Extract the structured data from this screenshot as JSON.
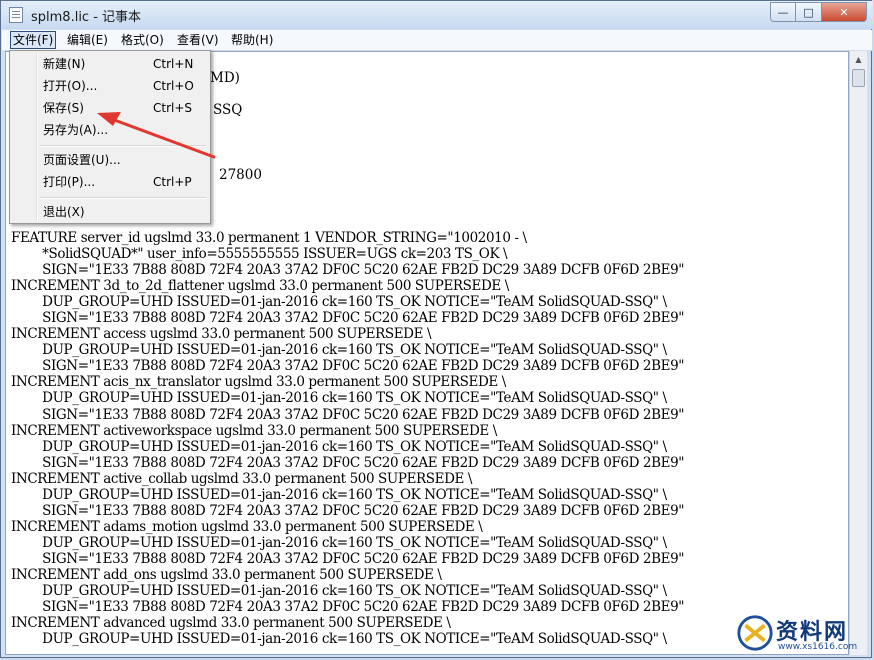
{
  "window": {
    "title": "splm8.lic - 记事本"
  },
  "title_buttons": {
    "minimize": "—",
    "maximize": "□",
    "close": "✕"
  },
  "menubar": [
    {
      "label": "文件(F)"
    },
    {
      "label": "编辑(E)"
    },
    {
      "label": "格式(O)"
    },
    {
      "label": "查看(V)"
    },
    {
      "label": "帮助(H)"
    }
  ],
  "file_menu": {
    "items": [
      {
        "label": "新建(N)",
        "accel": "Ctrl+N"
      },
      {
        "label": "打开(O)...",
        "accel": "Ctrl+O"
      },
      {
        "label": "保存(S)",
        "accel": "Ctrl+S"
      },
      {
        "label": "另存为(A)...",
        "accel": ""
      },
      {
        "label": "页面设置(U)...",
        "accel": ""
      },
      {
        "label": "打印(P)...",
        "accel": "Ctrl+P"
      },
      {
        "label": "退出(X)",
        "accel": ""
      }
    ]
  },
  "hidden_fragments": [
    "MD)",
    "SSQ",
    "27800"
  ],
  "document_text": "FEATURE server_id ugslmd 33.0 permanent 1 VENDOR_STRING=\"1002010 - \\\n\t*SolidSQUAD*\" user_info=5555555555 ISSUER=UGS ck=203 TS_OK \\\n\tSIGN=\"1E33 7B88 808D 72F4 20A3 37A2 DF0C 5C20 62AE FB2D DC29 3A89 DCFB 0F6D 2BE9\"\nINCREMENT 3d_to_2d_flattener ugslmd 33.0 permanent 500 SUPERSEDE \\\n\tDUP_GROUP=UHD ISSUED=01-jan-2016 ck=160 TS_OK NOTICE=\"TeAM SolidSQUAD-SSQ\" \\\n\tSIGN=\"1E33 7B88 808D 72F4 20A3 37A2 DF0C 5C20 62AE FB2D DC29 3A89 DCFB 0F6D 2BE9\"\nINCREMENT access ugslmd 33.0 permanent 500 SUPERSEDE \\\n\tDUP_GROUP=UHD ISSUED=01-jan-2016 ck=160 TS_OK NOTICE=\"TeAM SolidSQUAD-SSQ\" \\\n\tSIGN=\"1E33 7B88 808D 72F4 20A3 37A2 DF0C 5C20 62AE FB2D DC29 3A89 DCFB 0F6D 2BE9\"\nINCREMENT acis_nx_translator ugslmd 33.0 permanent 500 SUPERSEDE \\\n\tDUP_GROUP=UHD ISSUED=01-jan-2016 ck=160 TS_OK NOTICE=\"TeAM SolidSQUAD-SSQ\" \\\n\tSIGN=\"1E33 7B88 808D 72F4 20A3 37A2 DF0C 5C20 62AE FB2D DC29 3A89 DCFB 0F6D 2BE9\"\nINCREMENT activeworkspace ugslmd 33.0 permanent 500 SUPERSEDE \\\n\tDUP_GROUP=UHD ISSUED=01-jan-2016 ck=160 TS_OK NOTICE=\"TeAM SolidSQUAD-SSQ\" \\\n\tSIGN=\"1E33 7B88 808D 72F4 20A3 37A2 DF0C 5C20 62AE FB2D DC29 3A89 DCFB 0F6D 2BE9\"\nINCREMENT active_collab ugslmd 33.0 permanent 500 SUPERSEDE \\\n\tDUP_GROUP=UHD ISSUED=01-jan-2016 ck=160 TS_OK NOTICE=\"TeAM SolidSQUAD-SSQ\" \\\n\tSIGN=\"1E33 7B88 808D 72F4 20A3 37A2 DF0C 5C20 62AE FB2D DC29 3A89 DCFB 0F6D 2BE9\"\nINCREMENT adams_motion ugslmd 33.0 permanent 500 SUPERSEDE \\\n\tDUP_GROUP=UHD ISSUED=01-jan-2016 ck=160 TS_OK NOTICE=\"TeAM SolidSQUAD-SSQ\" \\\n\tSIGN=\"1E33 7B88 808D 72F4 20A3 37A2 DF0C 5C20 62AE FB2D DC29 3A89 DCFB 0F6D 2BE9\"\nINCREMENT add_ons ugslmd 33.0 permanent 500 SUPERSEDE \\\n\tDUP_GROUP=UHD ISSUED=01-jan-2016 ck=160 TS_OK NOTICE=\"TeAM SolidSQUAD-SSQ\" \\\n\tSIGN=\"1E33 7B88 808D 72F4 20A3 37A2 DF0C 5C20 62AE FB2D DC29 3A89 DCFB 0F6D 2BE9\"\nINCREMENT advanced ugslmd 33.0 permanent 500 SUPERSEDE \\\n\tDUP_GROUP=UHD ISSUED=01-jan-2016 ck=160 TS_OK NOTICE=\"TeAM SolidSQUAD-SSQ\" \\",
  "watermark": {
    "text": "资料网",
    "url": "www.xs1616.com"
  },
  "colors": {
    "annotation_arrow": "#e0382f",
    "window_frame": "#cfe0f4",
    "close_button": "#c94c33"
  }
}
